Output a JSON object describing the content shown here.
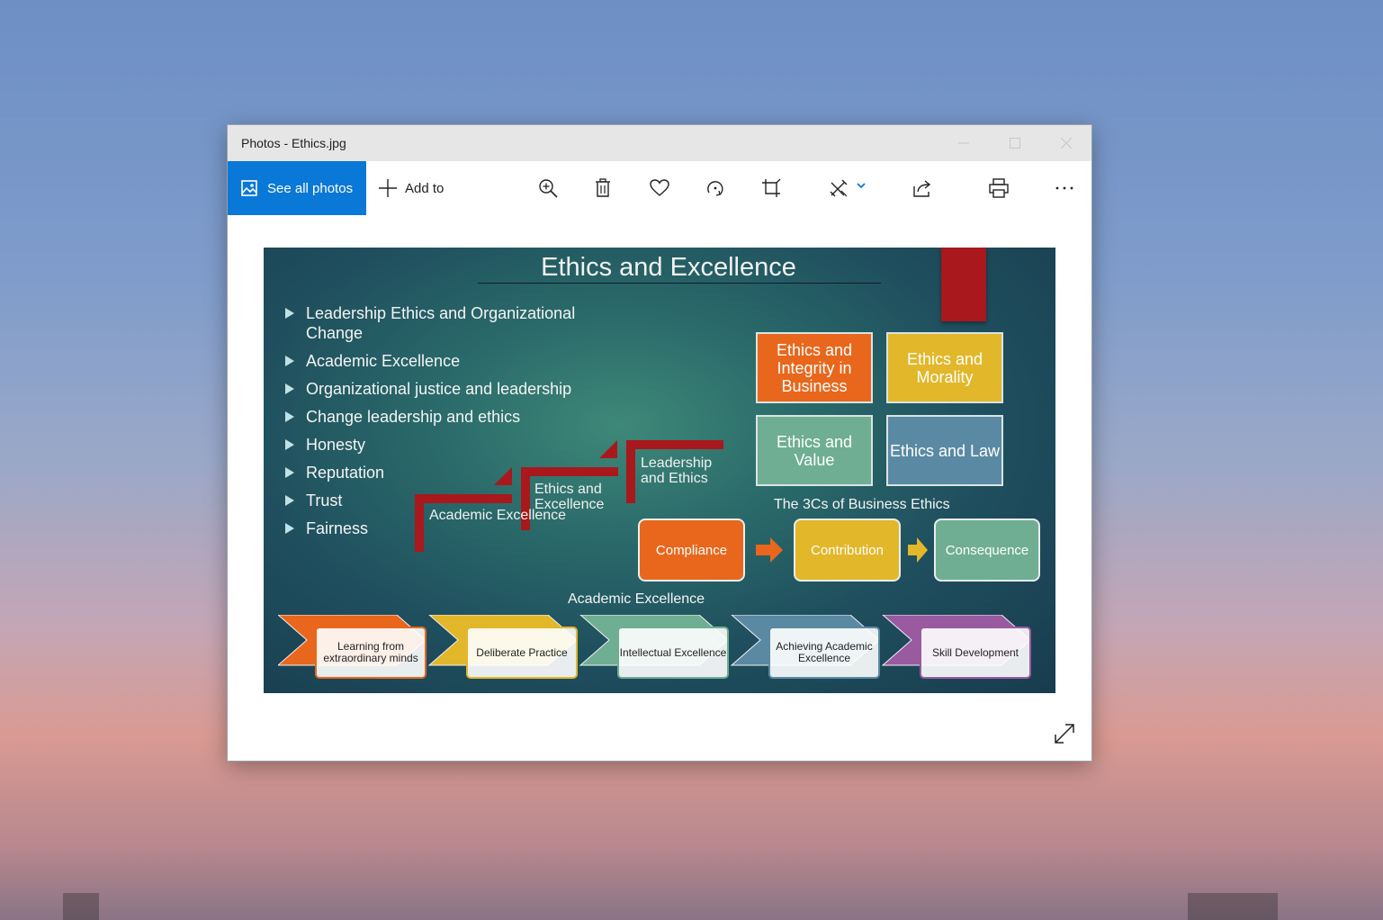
{
  "window": {
    "title": "Photos - Ethics.jpg"
  },
  "toolbar": {
    "see_all_label": "See all photos",
    "add_to_label": "Add to",
    "icons": [
      "zoom-in-icon",
      "delete-icon",
      "favorite-icon",
      "rotate-icon",
      "crop-icon",
      "edit-icon",
      "share-icon",
      "print-icon",
      "more-icon"
    ]
  },
  "colors": {
    "accent": "#0a78d7",
    "orange": "#e8671c",
    "yellow": "#e2b72a",
    "green": "#6fae93",
    "steel": "#5a8aa3",
    "red": "#a8181c",
    "purple": "#9a5aa0"
  },
  "slide": {
    "title": "Ethics and Excellence",
    "bullets": [
      "Leadership Ethics and Organizational Change",
      "Academic Excellence",
      "Organizational justice and leadership",
      "Change leadership and ethics",
      "Honesty",
      "Reputation",
      "Trust",
      "Fairness"
    ],
    "tiles": [
      "Ethics and Integrity in Business",
      "Ethics and Morality",
      "Ethics and Value",
      "Ethics and Law"
    ],
    "steps": [
      "Academic Excellence",
      "Ethics and Excellence",
      "Leadership and Ethics"
    ],
    "three_cs": {
      "title": "The 3Cs of Business Ethics",
      "items": [
        "Compliance",
        "Contribution",
        "Consequence"
      ]
    },
    "academic_excellence": {
      "title": "Academic Excellence",
      "items": [
        "Learning from extraordinary minds",
        "Deliberate Practice",
        "Intellectual Excellence",
        "Achieving Academic Excellence",
        "Skill Development"
      ]
    }
  }
}
